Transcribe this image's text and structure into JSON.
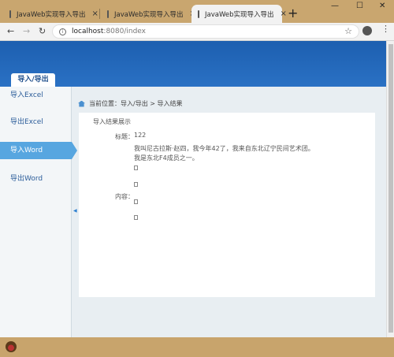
{
  "browser": {
    "tabs": [
      {
        "title": "JavaWeb实现导入导出",
        "active": false
      },
      {
        "title": "JavaWeb实现导入导出",
        "active": false
      },
      {
        "title": "JavaWeb实现导入导出",
        "active": true
      }
    ],
    "close_glyph": "×",
    "new_tab_glyph": "+",
    "window_controls": [
      "—",
      "☐",
      "✕"
    ],
    "url_host": "localhost",
    "url_path": ":8080/index"
  },
  "header": {
    "active_tab": "导入/导出"
  },
  "sidebar": {
    "items": [
      {
        "label": "导入Excel",
        "active": false
      },
      {
        "label": "导出Excel",
        "active": false
      },
      {
        "label": "导入Word",
        "active": true
      },
      {
        "label": "导出Word",
        "active": false
      }
    ]
  },
  "breadcrumb": {
    "text": "当前位置：导入/导出 > 导入结果"
  },
  "result": {
    "title": "导入结果展示",
    "title_label": "标题：",
    "title_value": "122",
    "content_label": "内容：",
    "content_line1": "我叫尼古拉斯·赵四，我今年42了，我来自东北辽宁民间艺术团。",
    "content_line2": "我是东北F4成员之一。"
  },
  "colors": {
    "banner": "#2a71c4",
    "sidebar_active": "#57a6e0",
    "link_text": "#2c5d9a"
  }
}
